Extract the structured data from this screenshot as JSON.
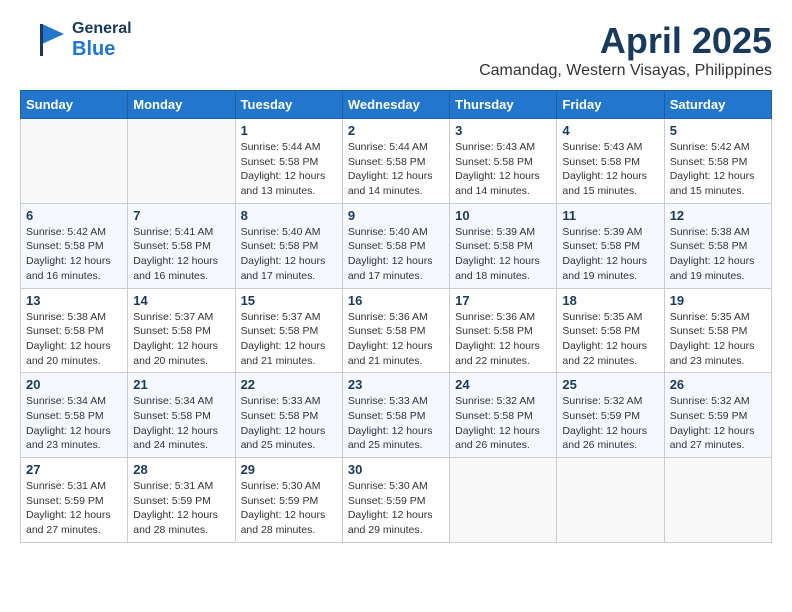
{
  "header": {
    "logo_general": "General",
    "logo_blue": "Blue",
    "month_title": "April 2025",
    "location": "Camandag, Western Visayas, Philippines"
  },
  "weekdays": [
    "Sunday",
    "Monday",
    "Tuesday",
    "Wednesday",
    "Thursday",
    "Friday",
    "Saturday"
  ],
  "weeks": [
    [
      {
        "day": "",
        "sunrise": "",
        "sunset": "",
        "daylight": ""
      },
      {
        "day": "",
        "sunrise": "",
        "sunset": "",
        "daylight": ""
      },
      {
        "day": "1",
        "sunrise": "Sunrise: 5:44 AM",
        "sunset": "Sunset: 5:58 PM",
        "daylight": "Daylight: 12 hours and 13 minutes."
      },
      {
        "day": "2",
        "sunrise": "Sunrise: 5:44 AM",
        "sunset": "Sunset: 5:58 PM",
        "daylight": "Daylight: 12 hours and 14 minutes."
      },
      {
        "day": "3",
        "sunrise": "Sunrise: 5:43 AM",
        "sunset": "Sunset: 5:58 PM",
        "daylight": "Daylight: 12 hours and 14 minutes."
      },
      {
        "day": "4",
        "sunrise": "Sunrise: 5:43 AM",
        "sunset": "Sunset: 5:58 PM",
        "daylight": "Daylight: 12 hours and 15 minutes."
      },
      {
        "day": "5",
        "sunrise": "Sunrise: 5:42 AM",
        "sunset": "Sunset: 5:58 PM",
        "daylight": "Daylight: 12 hours and 15 minutes."
      }
    ],
    [
      {
        "day": "6",
        "sunrise": "Sunrise: 5:42 AM",
        "sunset": "Sunset: 5:58 PM",
        "daylight": "Daylight: 12 hours and 16 minutes."
      },
      {
        "day": "7",
        "sunrise": "Sunrise: 5:41 AM",
        "sunset": "Sunset: 5:58 PM",
        "daylight": "Daylight: 12 hours and 16 minutes."
      },
      {
        "day": "8",
        "sunrise": "Sunrise: 5:40 AM",
        "sunset": "Sunset: 5:58 PM",
        "daylight": "Daylight: 12 hours and 17 minutes."
      },
      {
        "day": "9",
        "sunrise": "Sunrise: 5:40 AM",
        "sunset": "Sunset: 5:58 PM",
        "daylight": "Daylight: 12 hours and 17 minutes."
      },
      {
        "day": "10",
        "sunrise": "Sunrise: 5:39 AM",
        "sunset": "Sunset: 5:58 PM",
        "daylight": "Daylight: 12 hours and 18 minutes."
      },
      {
        "day": "11",
        "sunrise": "Sunrise: 5:39 AM",
        "sunset": "Sunset: 5:58 PM",
        "daylight": "Daylight: 12 hours and 19 minutes."
      },
      {
        "day": "12",
        "sunrise": "Sunrise: 5:38 AM",
        "sunset": "Sunset: 5:58 PM",
        "daylight": "Daylight: 12 hours and 19 minutes."
      }
    ],
    [
      {
        "day": "13",
        "sunrise": "Sunrise: 5:38 AM",
        "sunset": "Sunset: 5:58 PM",
        "daylight": "Daylight: 12 hours and 20 minutes."
      },
      {
        "day": "14",
        "sunrise": "Sunrise: 5:37 AM",
        "sunset": "Sunset: 5:58 PM",
        "daylight": "Daylight: 12 hours and 20 minutes."
      },
      {
        "day": "15",
        "sunrise": "Sunrise: 5:37 AM",
        "sunset": "Sunset: 5:58 PM",
        "daylight": "Daylight: 12 hours and 21 minutes."
      },
      {
        "day": "16",
        "sunrise": "Sunrise: 5:36 AM",
        "sunset": "Sunset: 5:58 PM",
        "daylight": "Daylight: 12 hours and 21 minutes."
      },
      {
        "day": "17",
        "sunrise": "Sunrise: 5:36 AM",
        "sunset": "Sunset: 5:58 PM",
        "daylight": "Daylight: 12 hours and 22 minutes."
      },
      {
        "day": "18",
        "sunrise": "Sunrise: 5:35 AM",
        "sunset": "Sunset: 5:58 PM",
        "daylight": "Daylight: 12 hours and 22 minutes."
      },
      {
        "day": "19",
        "sunrise": "Sunrise: 5:35 AM",
        "sunset": "Sunset: 5:58 PM",
        "daylight": "Daylight: 12 hours and 23 minutes."
      }
    ],
    [
      {
        "day": "20",
        "sunrise": "Sunrise: 5:34 AM",
        "sunset": "Sunset: 5:58 PM",
        "daylight": "Daylight: 12 hours and 23 minutes."
      },
      {
        "day": "21",
        "sunrise": "Sunrise: 5:34 AM",
        "sunset": "Sunset: 5:58 PM",
        "daylight": "Daylight: 12 hours and 24 minutes."
      },
      {
        "day": "22",
        "sunrise": "Sunrise: 5:33 AM",
        "sunset": "Sunset: 5:58 PM",
        "daylight": "Daylight: 12 hours and 25 minutes."
      },
      {
        "day": "23",
        "sunrise": "Sunrise: 5:33 AM",
        "sunset": "Sunset: 5:58 PM",
        "daylight": "Daylight: 12 hours and 25 minutes."
      },
      {
        "day": "24",
        "sunrise": "Sunrise: 5:32 AM",
        "sunset": "Sunset: 5:58 PM",
        "daylight": "Daylight: 12 hours and 26 minutes."
      },
      {
        "day": "25",
        "sunrise": "Sunrise: 5:32 AM",
        "sunset": "Sunset: 5:59 PM",
        "daylight": "Daylight: 12 hours and 26 minutes."
      },
      {
        "day": "26",
        "sunrise": "Sunrise: 5:32 AM",
        "sunset": "Sunset: 5:59 PM",
        "daylight": "Daylight: 12 hours and 27 minutes."
      }
    ],
    [
      {
        "day": "27",
        "sunrise": "Sunrise: 5:31 AM",
        "sunset": "Sunset: 5:59 PM",
        "daylight": "Daylight: 12 hours and 27 minutes."
      },
      {
        "day": "28",
        "sunrise": "Sunrise: 5:31 AM",
        "sunset": "Sunset: 5:59 PM",
        "daylight": "Daylight: 12 hours and 28 minutes."
      },
      {
        "day": "29",
        "sunrise": "Sunrise: 5:30 AM",
        "sunset": "Sunset: 5:59 PM",
        "daylight": "Daylight: 12 hours and 28 minutes."
      },
      {
        "day": "30",
        "sunrise": "Sunrise: 5:30 AM",
        "sunset": "Sunset: 5:59 PM",
        "daylight": "Daylight: 12 hours and 29 minutes."
      },
      {
        "day": "",
        "sunrise": "",
        "sunset": "",
        "daylight": ""
      },
      {
        "day": "",
        "sunrise": "",
        "sunset": "",
        "daylight": ""
      },
      {
        "day": "",
        "sunrise": "",
        "sunset": "",
        "daylight": ""
      }
    ]
  ]
}
